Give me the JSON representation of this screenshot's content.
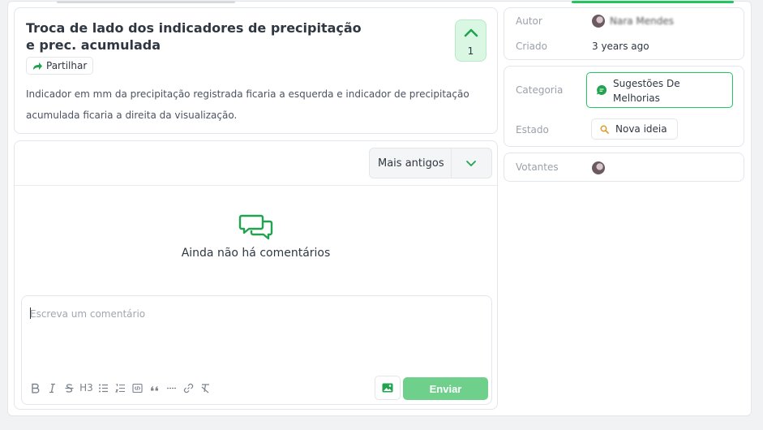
{
  "post": {
    "title": "Troca de lado dos indicadores de precipitação e prec. acumulada",
    "vote_count": "1",
    "share_label": "Partilhar",
    "description": "Indicador em mm da precipitação registrada ficaria a esquerda e indicador de precipitação acumulada ficaria a direita da visualização."
  },
  "comments": {
    "sort_label": "Mais antigos",
    "empty_text": "Ainda não há comentários",
    "editor_placeholder": "Escreva um comentário",
    "send_label": "Enviar",
    "toolbar": [
      "bold-icon",
      "italic-icon",
      "strikethrough-icon",
      "heading-3-icon",
      "bullet-list-icon",
      "numbered-list-icon",
      "code-block-icon",
      "quote-icon",
      "horizontal-rule-icon",
      "link-icon",
      "clear-format-icon"
    ],
    "toolbar_h3": "H3"
  },
  "meta": {
    "author_label": "Autor",
    "author_name": "Nara Mendes",
    "created_label": "Criado",
    "created_value": "3 years ago",
    "category_label": "Categoria",
    "category_value": "Sugestões De Melhorias",
    "state_label": "Estado",
    "state_value": "Nova ideia",
    "voters_label": "Votantes"
  },
  "colors": {
    "accent": "#22c55e",
    "vote_bg": "#d9f7e3",
    "send_bg": "#6ed08a",
    "state_icon": "#e09a2b"
  }
}
